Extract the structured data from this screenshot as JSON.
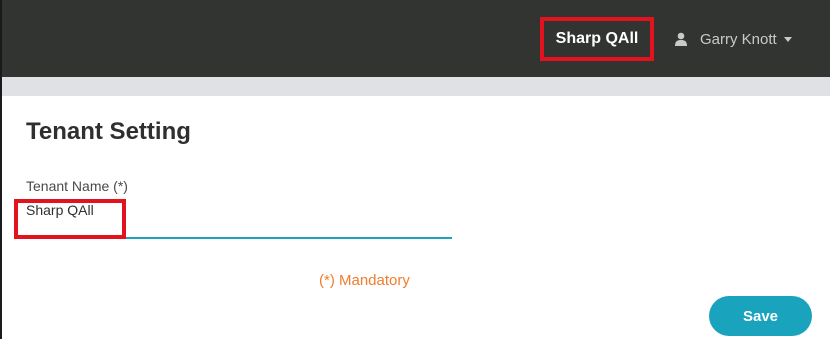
{
  "topbar": {
    "tenant_name": "Sharp QAll",
    "user": {
      "name": "Garry Knott",
      "icon": "user-icon"
    }
  },
  "page": {
    "title": "Tenant Setting"
  },
  "form": {
    "tenant_name_label": "Tenant Name (*)",
    "tenant_name_value": "Sharp QAll",
    "mandatory_note": "(*) Mandatory",
    "save_label": "Save"
  },
  "colors": {
    "topbar_bg": "#323432",
    "accent": "#1aa3bd",
    "highlight_border": "#e3121f",
    "mandatory_text": "#f07d2e"
  }
}
